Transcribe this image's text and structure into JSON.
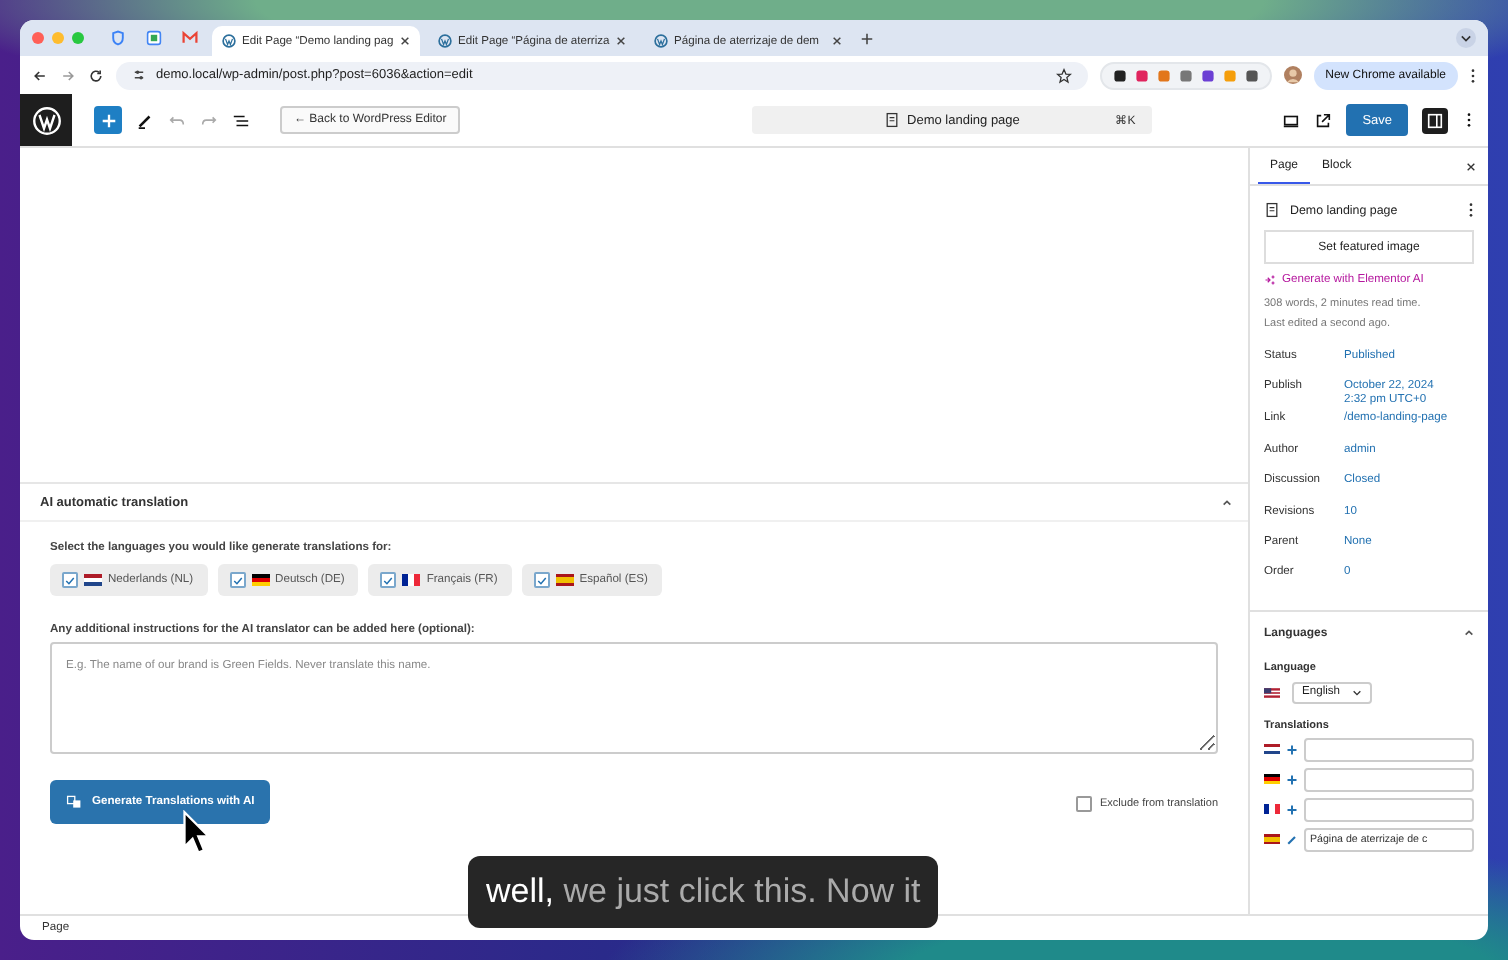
{
  "browser": {
    "tabs": [
      {
        "title": "Edit Page “Demo landing pag",
        "selected": true
      },
      {
        "title": "Edit Page “Página de aterriza",
        "selected": false
      },
      {
        "title": "Página de aterrizaje de dem",
        "selected": false
      }
    ],
    "url": "demo.local/wp-admin/post.php?post=6036&action=edit",
    "notice": "New Chrome available"
  },
  "toolbar": {
    "back_button": "← Back to WordPress Editor",
    "command_bar": {
      "title": "Demo landing page",
      "shortcut": "⌘K"
    },
    "save_button": "Save"
  },
  "meta_box": {
    "title": "AI automatic translation",
    "prompt": "Select the languages you would like generate translations for:",
    "languages": [
      {
        "label": "Nederlands (NL)",
        "checked": true
      },
      {
        "label": "Deutsch (DE)",
        "checked": true
      },
      {
        "label": "Français (FR)",
        "checked": true
      },
      {
        "label": "Español (ES)",
        "checked": true
      }
    ],
    "instructions_label": "Any additional instructions for the AI translator can be added here (optional):",
    "instructions": {
      "placeholder": "E.g. The name of our brand is Green Fields. Never translate this name."
    },
    "generate_button": "Generate Translations with AI",
    "exclude": {
      "label": "Exclude from translation",
      "checked": false
    }
  },
  "sidebar": {
    "tabs": [
      {
        "label": "Page",
        "selected": true
      },
      {
        "label": "Block",
        "selected": false
      }
    ],
    "post_title": "Demo landing page",
    "featured_button": "Set featured image",
    "ai_link": "Generate with Elementor AI",
    "stats": [
      "308 words, 2 minutes read time.",
      "Last edited a second ago."
    ],
    "fields": [
      {
        "label": "Status",
        "value": "Published"
      },
      {
        "label": "Publish",
        "value": "October 22, 2024 2:32 pm UTC+0"
      },
      {
        "label": "Link",
        "value": "/demo-landing-page"
      },
      {
        "label": "Author",
        "value": "admin"
      },
      {
        "label": "Discussion",
        "value": "Closed"
      },
      {
        "label": "Revisions",
        "value": "10"
      },
      {
        "label": "Parent",
        "value": "None"
      },
      {
        "label": "Order",
        "value": "0"
      }
    ],
    "languages": {
      "title": "Languages",
      "language_label": "Language",
      "language": "English",
      "translations_label": "Translations",
      "translations": [
        {
          "kind": "add"
        },
        {
          "kind": "add"
        },
        {
          "kind": "add"
        },
        {
          "kind": "edit",
          "value": "Página de aterrizaje de c"
        }
      ]
    }
  },
  "footer": "Page",
  "caption": "**well,** we just click this. Now it"
}
